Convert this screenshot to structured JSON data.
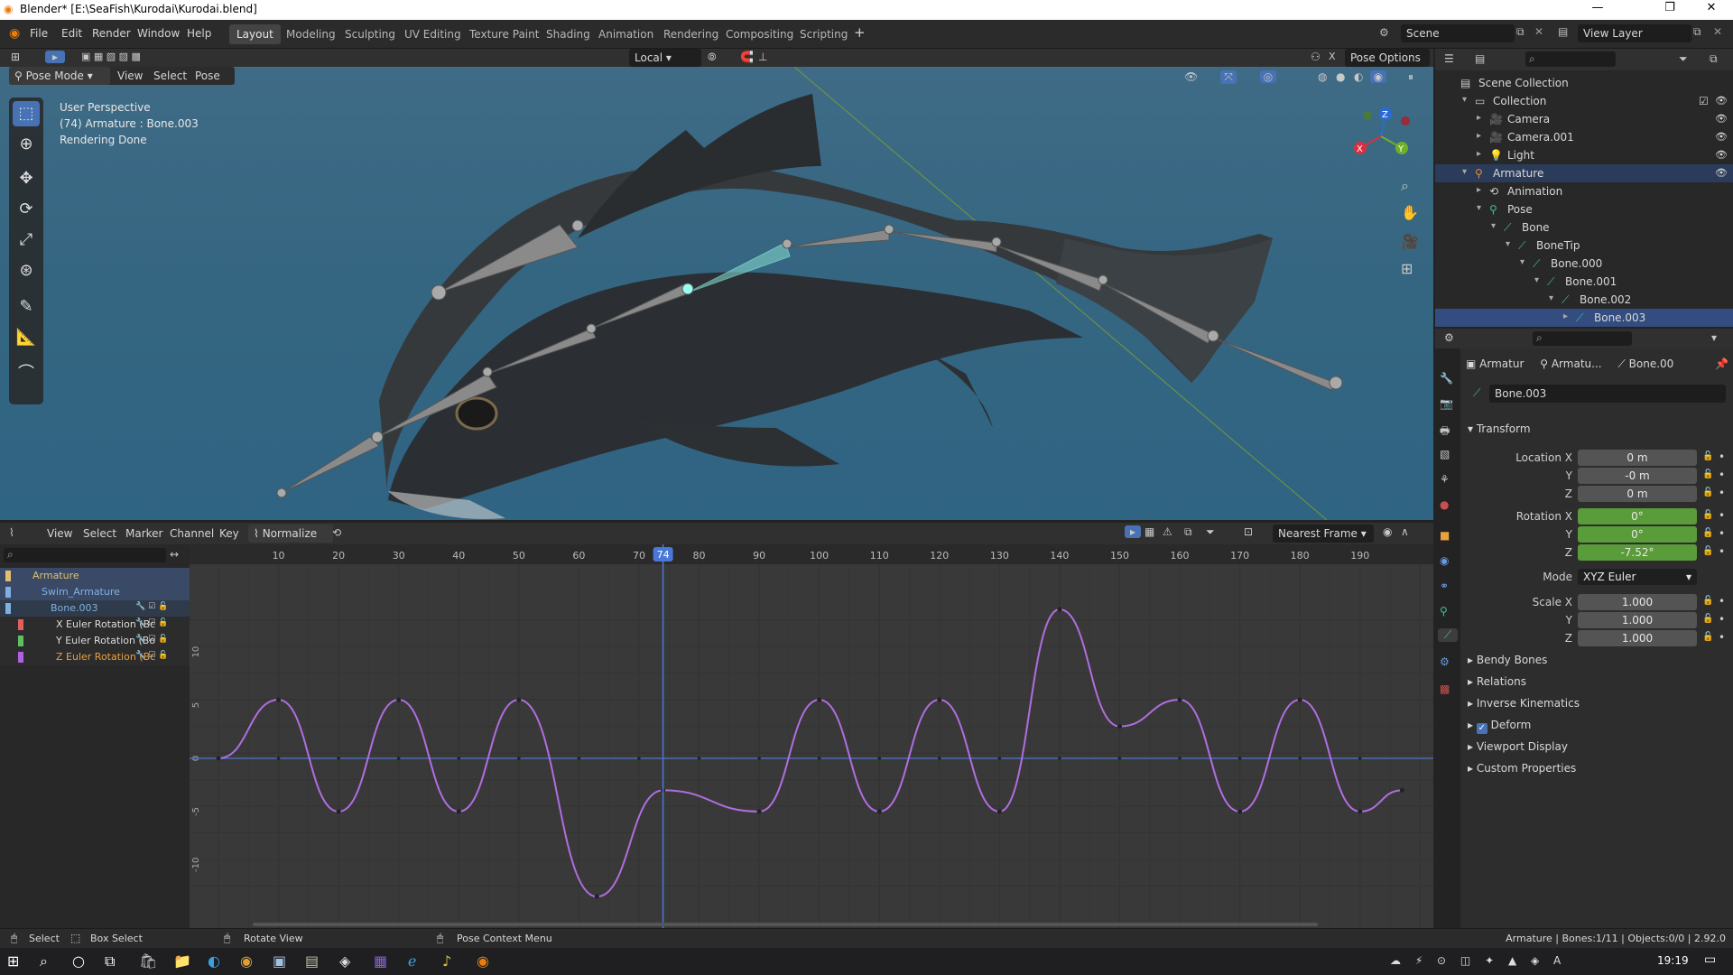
{
  "window": {
    "title": "Blender* [E:\\SeaFish\\Kurodai\\Kurodai.blend]"
  },
  "menus": [
    "File",
    "Edit",
    "Render",
    "Window",
    "Help"
  ],
  "workspaces": [
    "Layout",
    "Modeling",
    "Sculpting",
    "UV Editing",
    "Texture Paint",
    "Shading",
    "Animation",
    "Rendering",
    "Compositing",
    "Scripting"
  ],
  "active_workspace": "Layout",
  "scene": {
    "scene_name": "Scene",
    "view_layer": "View Layer"
  },
  "viewport": {
    "mode": "Pose Mode",
    "menu": [
      "View",
      "Select",
      "Pose"
    ],
    "transform_orientation": "Local",
    "pose_options": "Pose Options",
    "info_line1": "User Perspective",
    "info_line2": "(74) Armature : Bone.003",
    "info_line3": "Rendering Done",
    "gizmo_axes": {
      "x": "X",
      "y": "Y",
      "z": "Z"
    }
  },
  "graph_editor": {
    "menu": [
      "View",
      "Select",
      "Marker",
      "Channel",
      "Key"
    ],
    "normalize_label": "Normalize",
    "snap_mode": "Nearest Frame",
    "current_frame": "74",
    "frame_ticks": [
      "10",
      "20",
      "30",
      "40",
      "50",
      "60",
      "70",
      "80",
      "90",
      "100",
      "110",
      "120",
      "130",
      "140",
      "150",
      "160",
      "170",
      "180",
      "190"
    ],
    "value_ticks": [
      "10",
      "5",
      "0",
      "-5",
      "-10"
    ],
    "channels": [
      {
        "label": "Armature",
        "level": 0,
        "color": "#e0c070"
      },
      {
        "label": "Swim_Armature",
        "level": 1,
        "color": "#7fb0e0"
      },
      {
        "label": "Bone.003",
        "level": 2,
        "color": "#7fb0e0"
      },
      {
        "label": "X Euler Rotation (Bc",
        "level": 3,
        "color": "#e06060"
      },
      {
        "label": "Y Euler Rotation (Bo",
        "level": 3,
        "color": "#60c060"
      },
      {
        "label": "Z Euler Rotation (Bc",
        "level": 3,
        "color": "#b060e0"
      }
    ]
  },
  "outliner": {
    "rows": [
      {
        "label": "Scene Collection",
        "indent": 0
      },
      {
        "label": "Collection",
        "indent": 1
      },
      {
        "label": "Camera",
        "indent": 2
      },
      {
        "label": "Camera.001",
        "indent": 2
      },
      {
        "label": "Light",
        "indent": 2
      },
      {
        "label": "Armature",
        "indent": 1
      },
      {
        "label": "Animation",
        "indent": 2
      },
      {
        "label": "Pose",
        "indent": 2
      },
      {
        "label": "Bone",
        "indent": 3
      },
      {
        "label": "BoneTip",
        "indent": 4
      },
      {
        "label": "Bone.000",
        "indent": 5
      },
      {
        "label": "Bone.001",
        "indent": 6
      },
      {
        "label": "Bone.002",
        "indent": 7
      },
      {
        "label": "Bone.003",
        "indent": 8
      }
    ]
  },
  "properties": {
    "breadcrumb": [
      "Armatur",
      "Armatu...",
      "Bone.00"
    ],
    "bone_name": "Bone.003",
    "transform_label": "Transform",
    "location": {
      "label_x": "Location X",
      "x": "0 m",
      "y": "-0 m",
      "z": "0 m"
    },
    "rotation": {
      "label_x": "Rotation X",
      "x": "0°",
      "y": "0°",
      "z": "-7.52°"
    },
    "mode_label": "Mode",
    "mode_value": "XYZ Euler",
    "scale": {
      "label_x": "Scale X",
      "x": "1.000",
      "y": "1.000",
      "z": "1.000"
    },
    "axis_y": "Y",
    "axis_z": "Z",
    "panels": [
      "Bendy Bones",
      "Relations",
      "Inverse Kinematics",
      "Deform",
      "Viewport Display",
      "Custom Properties"
    ]
  },
  "statusbar": {
    "select": "Select",
    "box_select": "Box Select",
    "rotate_view": "Rotate View",
    "context_menu": "Pose Context Menu",
    "stats": "Armature | Bones:1/11 | Objects:0/0 | 2.92.0"
  },
  "taskbar": {
    "time": "19:19"
  },
  "curve": {
    "keys": [
      [
        0,
        0
      ],
      [
        10,
        5.5
      ],
      [
        20,
        -5
      ],
      [
        30,
        5.5
      ],
      [
        40,
        -5
      ],
      [
        50,
        5.5
      ],
      [
        63,
        -13
      ],
      [
        74,
        -3
      ],
      [
        90,
        -5
      ],
      [
        100,
        5.5
      ],
      [
        110,
        -5
      ],
      [
        120,
        5.5
      ],
      [
        130,
        -5
      ],
      [
        140,
        14
      ],
      [
        150,
        3
      ],
      [
        160,
        5.5
      ],
      [
        170,
        -5
      ],
      [
        180,
        5.5
      ],
      [
        190,
        -5
      ],
      [
        197,
        -3
      ]
    ]
  }
}
